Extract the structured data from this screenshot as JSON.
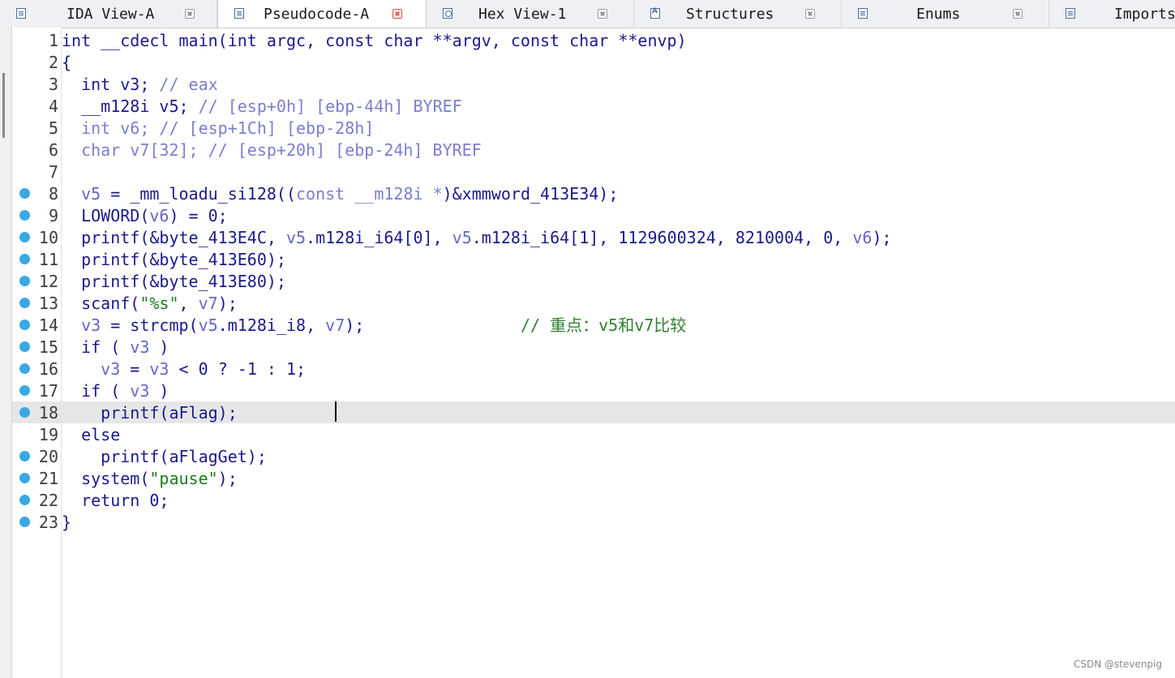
{
  "tabs": [
    {
      "label": "IDA View-A",
      "active": false,
      "icon": "disassembly-view-icon"
    },
    {
      "label": "Pseudocode-A",
      "active": true,
      "icon": "pseudocode-view-icon"
    },
    {
      "label": "Hex View-1",
      "active": false,
      "icon": "hex-view-icon"
    },
    {
      "label": "Structures",
      "active": false,
      "icon": "structures-icon"
    },
    {
      "label": "Enums",
      "active": false,
      "icon": "enums-icon"
    },
    {
      "label": "Imports",
      "active": false,
      "icon": "imports-icon"
    }
  ],
  "code_lines": [
    {
      "n": "1",
      "bp": false,
      "hl": false,
      "parts": [
        [
          "int __cdecl main(int argc, const char **argv, const char **envp)",
          ""
        ]
      ]
    },
    {
      "n": "2",
      "bp": false,
      "hl": false,
      "parts": [
        [
          "{",
          ""
        ]
      ]
    },
    {
      "n": "3",
      "bp": false,
      "hl": false,
      "parts": [
        [
          "  int v3; ",
          ""
        ],
        [
          "// eax",
          "c"
        ]
      ]
    },
    {
      "n": "4",
      "bp": false,
      "hl": false,
      "parts": [
        [
          "  __m128i v5; ",
          ""
        ],
        [
          "// [esp+0h] [ebp-44h] BYREF",
          "c"
        ]
      ]
    },
    {
      "n": "5",
      "bp": false,
      "hl": false,
      "parts": [
        [
          "  int v6; // [esp+1Ch] [ebp-28h]",
          "c"
        ]
      ]
    },
    {
      "n": "6",
      "bp": false,
      "hl": false,
      "parts": [
        [
          "  char v7[32]; // [esp+20h] [ebp-24h] BYREF",
          "c"
        ]
      ]
    },
    {
      "n": "7",
      "bp": false,
      "hl": false,
      "parts": [
        [
          "",
          ""
        ]
      ]
    },
    {
      "n": "8",
      "bp": true,
      "hl": false,
      "parts": [
        [
          "  ",
          ""
        ],
        [
          "v5",
          "v"
        ],
        [
          " = _mm_loadu_si128((",
          ""
        ],
        [
          "const __m128i *",
          "c"
        ],
        [
          ")&xmmword_413E34);",
          ""
        ]
      ]
    },
    {
      "n": "9",
      "bp": true,
      "hl": false,
      "parts": [
        [
          "  LOWORD(",
          ""
        ],
        [
          "v6",
          "v"
        ],
        [
          ") = 0;",
          ""
        ]
      ]
    },
    {
      "n": "10",
      "bp": true,
      "hl": false,
      "parts": [
        [
          "  printf(&byte_413E4C, ",
          ""
        ],
        [
          "v5",
          "v"
        ],
        [
          ".m128i_i64[0], ",
          ""
        ],
        [
          "v5",
          "v"
        ],
        [
          ".m128i_i64[1], 1129600324, 8210004, 0, ",
          ""
        ],
        [
          "v6",
          "v"
        ],
        [
          ");",
          ""
        ]
      ]
    },
    {
      "n": "11",
      "bp": true,
      "hl": false,
      "parts": [
        [
          "  printf(&byte_413E60);",
          ""
        ]
      ]
    },
    {
      "n": "12",
      "bp": true,
      "hl": false,
      "parts": [
        [
          "  printf(&byte_413E80);",
          ""
        ]
      ]
    },
    {
      "n": "13",
      "bp": true,
      "hl": false,
      "parts": [
        [
          "  scanf(",
          ""
        ],
        [
          "\"%s\"",
          "s"
        ],
        [
          ", ",
          ""
        ],
        [
          "v7",
          "v"
        ],
        [
          ");",
          ""
        ]
      ]
    },
    {
      "n": "14",
      "bp": true,
      "hl": false,
      "parts": [
        [
          "  ",
          ""
        ],
        [
          "v3",
          "v"
        ],
        [
          " = strcmp(",
          ""
        ],
        [
          "v5",
          "v"
        ],
        [
          ".m128i_i8, ",
          ""
        ],
        [
          "v7",
          "v"
        ],
        [
          ");                ",
          ""
        ],
        [
          "// 重点：v5和v7比较",
          "cm"
        ]
      ]
    },
    {
      "n": "15",
      "bp": true,
      "hl": false,
      "parts": [
        [
          "  if ( ",
          ""
        ],
        [
          "v3",
          "v"
        ],
        [
          " )",
          ""
        ]
      ]
    },
    {
      "n": "16",
      "bp": true,
      "hl": false,
      "parts": [
        [
          "    ",
          ""
        ],
        [
          "v3",
          "v"
        ],
        [
          " = ",
          ""
        ],
        [
          "v3",
          "v"
        ],
        [
          " < 0 ? -1 : 1;",
          ""
        ]
      ]
    },
    {
      "n": "17",
      "bp": true,
      "hl": false,
      "parts": [
        [
          "  if ( ",
          ""
        ],
        [
          "v3",
          "v"
        ],
        [
          " )",
          ""
        ]
      ]
    },
    {
      "n": "18",
      "bp": true,
      "hl": true,
      "parts": [
        [
          "    printf(aFlag);",
          ""
        ]
      ]
    },
    {
      "n": "19",
      "bp": false,
      "hl": false,
      "parts": [
        [
          "  else",
          ""
        ]
      ]
    },
    {
      "n": "20",
      "bp": true,
      "hl": false,
      "parts": [
        [
          "    printf(aFlagGet);",
          ""
        ]
      ]
    },
    {
      "n": "21",
      "bp": true,
      "hl": false,
      "parts": [
        [
          "  system(",
          ""
        ],
        [
          "\"pause\"",
          "s"
        ],
        [
          ");",
          ""
        ]
      ]
    },
    {
      "n": "22",
      "bp": true,
      "hl": false,
      "parts": [
        [
          "  return 0;",
          ""
        ]
      ]
    },
    {
      "n": "23",
      "bp": true,
      "hl": false,
      "parts": [
        [
          "}",
          ""
        ]
      ]
    }
  ],
  "watermark": "CSDN @stevenpig"
}
